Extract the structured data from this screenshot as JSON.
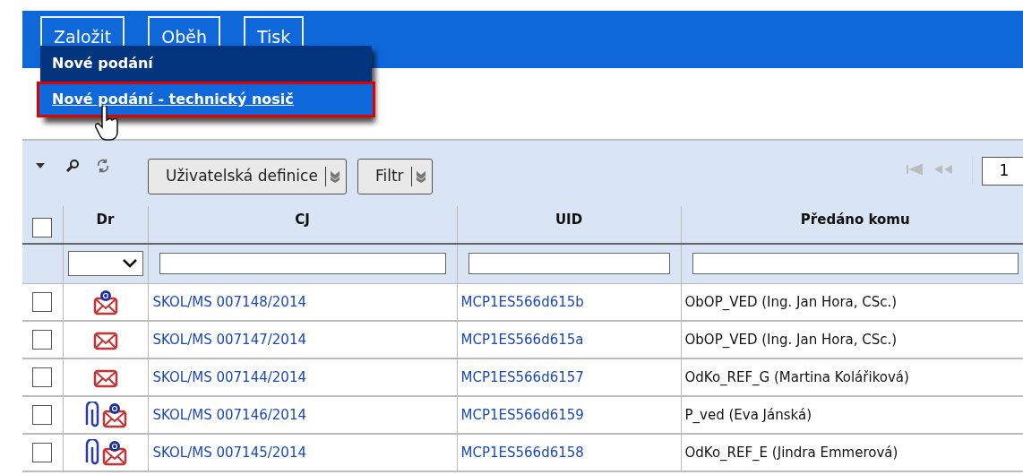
{
  "menu_bar": {
    "buttons": [
      "Založit",
      "Oběh",
      "Tisk"
    ]
  },
  "dropdown": {
    "items": [
      {
        "label": "Nové podání",
        "selected": false
      },
      {
        "label": "Nové podání - technický nosič",
        "selected": true
      }
    ]
  },
  "toolbar": {
    "buttons": [
      "Uživatelská definice",
      "Filtr"
    ],
    "page": "1"
  },
  "table": {
    "columns": [
      "Dr",
      "CJ",
      "UID",
      "Předáno komu"
    ],
    "all_checked": false,
    "rows": [
      {
        "checked": false,
        "attachment": false,
        "email": true,
        "cj": "SKOL/MS 007148/2014",
        "uid": "MCP1ES566d615b",
        "to": "ObOP_VED (Ing. Jan Hora, CSc.)"
      },
      {
        "checked": false,
        "attachment": false,
        "email": false,
        "cj": "SKOL/MS 007147/2014",
        "uid": "MCP1ES566d615a",
        "to": "ObOP_VED (Ing. Jan Hora, CSc.)"
      },
      {
        "checked": false,
        "attachment": false,
        "email": false,
        "cj": "SKOL/MS 007144/2014",
        "uid": "MCP1ES566d6157",
        "to": "OdKo_REF_G (Martina Kolářiková)"
      },
      {
        "checked": false,
        "attachment": true,
        "email": true,
        "cj": "SKOL/MS 007146/2014",
        "uid": "MCP1ES566d6159",
        "to": "P_ved (Eva Jánská)"
      },
      {
        "checked": false,
        "attachment": true,
        "email": true,
        "cj": "SKOL/MS 007145/2014",
        "uid": "MCP1ES566d6158",
        "to": "OdKo_REF_E (Jindra Emmerová)"
      }
    ]
  }
}
